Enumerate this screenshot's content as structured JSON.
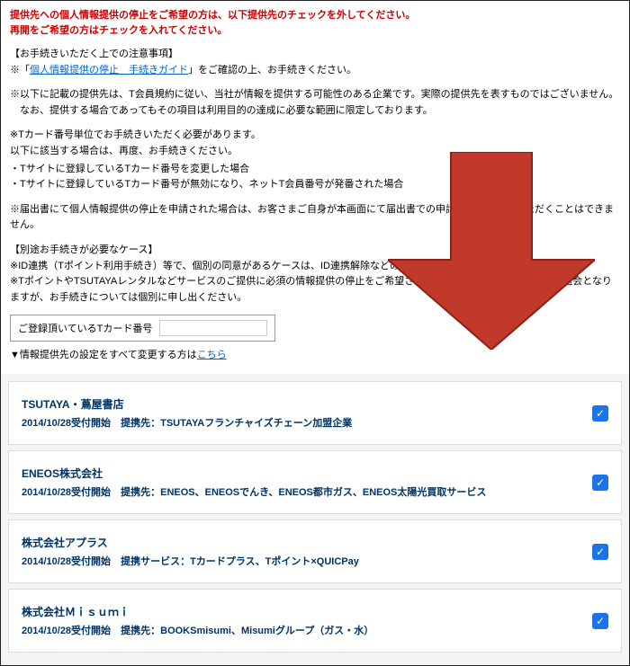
{
  "warning": {
    "line1": "提供先への個人情報提供の停止をご希望の方は、以下提供先のチェックを外してください。",
    "line2": "再開をご希望の方はチェックを入れてください。"
  },
  "notice": {
    "heading": "【お手続きいただく上での注意事項】",
    "prefix": "※「",
    "link": "個人情報提供の停止　手続きガイド",
    "suffix": "」をご確認の上、お手続きください。"
  },
  "disclaimer": {
    "line1": "※以下に記載の提供先は、T会員規約に従い、当社が情報を提供する可能性のある企業です。実際の提供先を表すものではございません。",
    "line2": "　なお、提供する場合であってもその項目は利用目的の達成に必要な範囲に限定しております。"
  },
  "cardnote": {
    "main": "※Tカード番号単位でお手続きいただく必要があります。",
    "sub": "以下に該当する場合は、再度、お手続きください。",
    "bullets": [
      "・Tサイトに登録しているTカード番号を変更した場合",
      "・Tサイトに登録しているTカード番号が無効になり、ネットT会員番号が発番された場合"
    ]
  },
  "submitted_note": "※届出書にて個人情報提供の停止を申請された場合は、お客さまご自身が本画面にて届出書での申請結果をご確認いただくことはできません。",
  "special": {
    "heading": "【別途お手続きが必要なケース】",
    "line1": "※ID連携（Tポイント利用手続き）等で、個別の同意があるケースは、ID連携解除などの手続が必要です。",
    "line2": "※TポイントやTSUTAYAレンタルなどサービスのご提供に必須の情報提供の停止をご希望される場合は、そのサービスからの退会となりますが、お手続きについては個別に申し出ください。"
  },
  "card_input": {
    "label": "ご登録頂いているTカード番号",
    "value": ""
  },
  "toggle_all": {
    "prefix": "▼情報提供先の設定をすべて変更する方は",
    "link": "こちら"
  },
  "companies": [
    {
      "name": "TSUTAYA・蔦屋書店",
      "date": "2014/10/28受付開始",
      "detail": "提携先：TSUTAYAフランチャイズチェーン加盟企業",
      "checked": true
    },
    {
      "name": "ENEOS株式会社",
      "date": "2014/10/28受付開始",
      "detail": "提携先：ENEOS、ENEOSでんき、ENEOS都市ガス、ENEOS太陽光買取サービス",
      "checked": true
    },
    {
      "name": "株式会社アプラス",
      "date": "2014/10/28受付開始",
      "detail": "提携サービス：Tカードプラス、Tポイント×QUICPay",
      "checked": true
    },
    {
      "name": "株式会社Ｍｉｓｕｍｉ",
      "date": "2014/10/28受付開始",
      "detail": "提携先：BOOKSmisumi、Misumiグループ（ガス・水）",
      "checked": true
    }
  ]
}
